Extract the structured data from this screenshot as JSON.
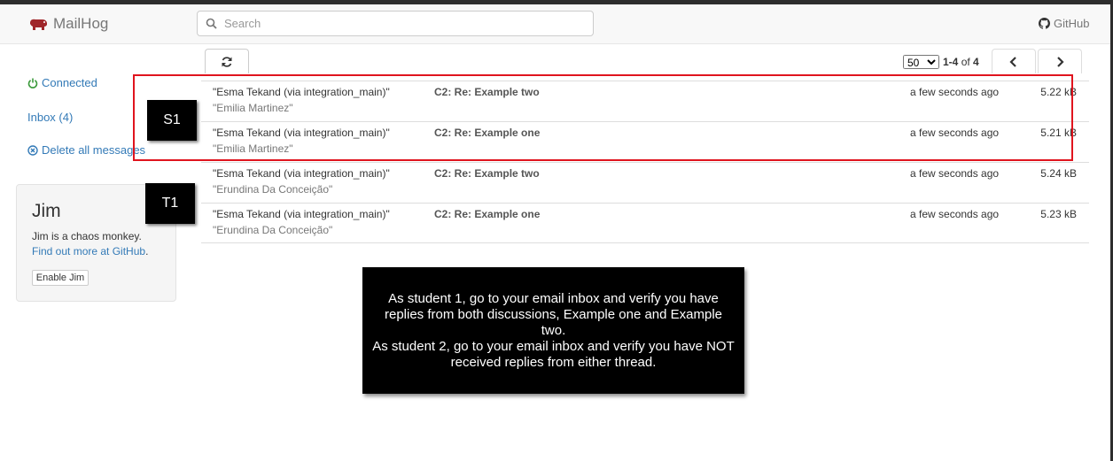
{
  "app": {
    "name": "MailHog"
  },
  "search": {
    "placeholder": "Search"
  },
  "header": {
    "github_label": "GitHub"
  },
  "sidebar": {
    "connected_label": "Connected",
    "inbox_label": "Inbox (4)",
    "delete_label": "Delete all messages"
  },
  "jim": {
    "title": "Jim",
    "description": "Jim is a chaos monkey.",
    "link_label": "Find out more at GitHub",
    "link_suffix": ".",
    "button_label": "Enable Jim"
  },
  "pager": {
    "per_page": "50",
    "per_page_options": [
      "50"
    ],
    "range": "1-4",
    "of_word": "of",
    "total": "4"
  },
  "messages": [
    {
      "from": "\"Esma Tekand (via integration_main)\"",
      "to": "\"Emilia Martinez\"",
      "subject": "C2: Re: Example two",
      "time": "a few seconds ago",
      "size": "5.22 kB"
    },
    {
      "from": "\"Esma Tekand (via integration_main)\"",
      "to": "\"Emilia Martinez\"",
      "subject": "C2: Re: Example one",
      "time": "a few seconds ago",
      "size": "5.21 kB"
    },
    {
      "from": "\"Esma Tekand (via integration_main)\"",
      "to": "\"Erundina Da Conceição\"",
      "subject": "C2: Re: Example two",
      "time": "a few seconds ago",
      "size": "5.24 kB"
    },
    {
      "from": "\"Esma Tekand (via integration_main)\"",
      "to": "\"Erundina Da Conceição\"",
      "subject": "C2: Re: Example one",
      "time": "a few seconds ago",
      "size": "5.23 kB"
    }
  ],
  "overlay": {
    "label_s1": "S1",
    "label_t1": "T1",
    "instruction_line1": "As student 1, go to your email inbox and verify you have replies from both discussions, Example one and Example two.",
    "instruction_line2": "As student 2, go to your email inbox and verify you have NOT received replies from either thread.",
    "highlight_color": "#e0141e"
  },
  "colors": {
    "link": "#337ab7",
    "connected": "#3c9a3c",
    "brand_icon": "#a0262a"
  }
}
